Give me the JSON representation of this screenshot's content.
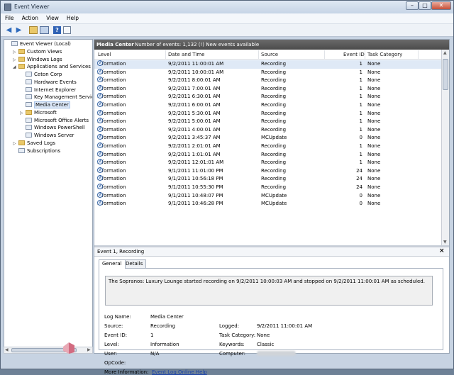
{
  "window": {
    "title": "Event Viewer"
  },
  "menu": [
    "File",
    "Action",
    "View",
    "Help"
  ],
  "tree": {
    "items": [
      {
        "label": "Event Viewer (Local)",
        "level": 0,
        "expander": "",
        "icon": "log"
      },
      {
        "label": "Custom Views",
        "level": 1,
        "expander": "▷",
        "icon": "folder"
      },
      {
        "label": "Windows Logs",
        "level": 1,
        "expander": "▷",
        "icon": "folder"
      },
      {
        "label": "Applications and Services Lo",
        "level": 1,
        "expander": "◢",
        "icon": "folder"
      },
      {
        "label": "Ceton Corp",
        "level": 2,
        "expander": "",
        "icon": "log"
      },
      {
        "label": "Hardware Events",
        "level": 2,
        "expander": "",
        "icon": "log"
      },
      {
        "label": "Internet Explorer",
        "level": 2,
        "expander": "",
        "icon": "log"
      },
      {
        "label": "Key Management Service",
        "level": 2,
        "expander": "",
        "icon": "log"
      },
      {
        "label": "Media Center",
        "level": 2,
        "expander": "",
        "icon": "log",
        "selected": true
      },
      {
        "label": "Microsoft",
        "level": 2,
        "expander": "▷",
        "icon": "folder"
      },
      {
        "label": "Microsoft Office Alerts",
        "level": 2,
        "expander": "",
        "icon": "log"
      },
      {
        "label": "Windows PowerShell",
        "level": 2,
        "expander": "",
        "icon": "log"
      },
      {
        "label": "Windows Server",
        "level": 2,
        "expander": "",
        "icon": "log"
      },
      {
        "label": "Saved Logs",
        "level": 1,
        "expander": "▷",
        "icon": "folder"
      },
      {
        "label": "Subscriptions",
        "level": 1,
        "expander": "",
        "icon": "log"
      }
    ]
  },
  "log_header": {
    "name": "Media Center",
    "count_text": "Number of events: 1,132 (!) New events available"
  },
  "columns": [
    "Level",
    "Date and Time",
    "Source",
    "Event ID",
    "Task Category"
  ],
  "events": [
    {
      "level": "Information",
      "date": "9/2/2011 11:00:01 AM",
      "source": "Recording",
      "id": "1",
      "category": "None",
      "selected": true
    },
    {
      "level": "Information",
      "date": "9/2/2011 10:00:01 AM",
      "source": "Recording",
      "id": "1",
      "category": "None"
    },
    {
      "level": "Information",
      "date": "9/2/2011 8:00:01 AM",
      "source": "Recording",
      "id": "1",
      "category": "None"
    },
    {
      "level": "Information",
      "date": "9/2/2011 7:00:01 AM",
      "source": "Recording",
      "id": "1",
      "category": "None"
    },
    {
      "level": "Information",
      "date": "9/2/2011 6:30:01 AM",
      "source": "Recording",
      "id": "1",
      "category": "None"
    },
    {
      "level": "Information",
      "date": "9/2/2011 6:00:01 AM",
      "source": "Recording",
      "id": "1",
      "category": "None"
    },
    {
      "level": "Information",
      "date": "9/2/2011 5:30:01 AM",
      "source": "Recording",
      "id": "1",
      "category": "None"
    },
    {
      "level": "Information",
      "date": "9/2/2011 5:00:01 AM",
      "source": "Recording",
      "id": "1",
      "category": "None"
    },
    {
      "level": "Information",
      "date": "9/2/2011 4:00:01 AM",
      "source": "Recording",
      "id": "1",
      "category": "None"
    },
    {
      "level": "Information",
      "date": "9/2/2011 3:45:37 AM",
      "source": "MCUpdate",
      "id": "0",
      "category": "None"
    },
    {
      "level": "Information",
      "date": "9/2/2011 2:01:01 AM",
      "source": "Recording",
      "id": "1",
      "category": "None"
    },
    {
      "level": "Information",
      "date": "9/2/2011 1:01:01 AM",
      "source": "Recording",
      "id": "1",
      "category": "None"
    },
    {
      "level": "Information",
      "date": "9/2/2011 12:01:01 AM",
      "source": "Recording",
      "id": "1",
      "category": "None"
    },
    {
      "level": "Information",
      "date": "9/1/2011 11:01:00 PM",
      "source": "Recording",
      "id": "24",
      "category": "None"
    },
    {
      "level": "Information",
      "date": "9/1/2011 10:56:18 PM",
      "source": "Recording",
      "id": "24",
      "category": "None"
    },
    {
      "level": "Information",
      "date": "9/1/2011 10:55:30 PM",
      "source": "Recording",
      "id": "24",
      "category": "None"
    },
    {
      "level": "Information",
      "date": "9/1/2011 10:48:07 PM",
      "source": "MCUpdate",
      "id": "0",
      "category": "None"
    },
    {
      "level": "Information",
      "date": "9/1/2011 10:46:28 PM",
      "source": "MCUpdate",
      "id": "0",
      "category": "None"
    }
  ],
  "detail": {
    "title": "Event 1, Recording",
    "close": "×",
    "tabs": [
      "General",
      "Details"
    ],
    "description": "The Sopranos: Luxury Lounge started recording on 9/2/2011 10:00:03 AM and stopped on 9/2/2011 11:00:01 AM as scheduled.",
    "labels": {
      "log_name": "Log Name:",
      "source": "Source:",
      "event_id": "Event ID:",
      "level": "Level:",
      "user": "User:",
      "opcode": "OpCode:",
      "more_info": "More Information:",
      "logged": "Logged:",
      "task_category": "Task Category:",
      "keywords": "Keywords:",
      "computer": "Computer:"
    },
    "values": {
      "log_name": "Media Center",
      "source": "Recording",
      "event_id": "1",
      "level": "Information",
      "user": "N/A",
      "opcode": "",
      "more_info_link": "Event Log Online Help",
      "logged": "9/2/2011 11:00:01 AM",
      "task_category": "None",
      "keywords": "Classic"
    }
  }
}
